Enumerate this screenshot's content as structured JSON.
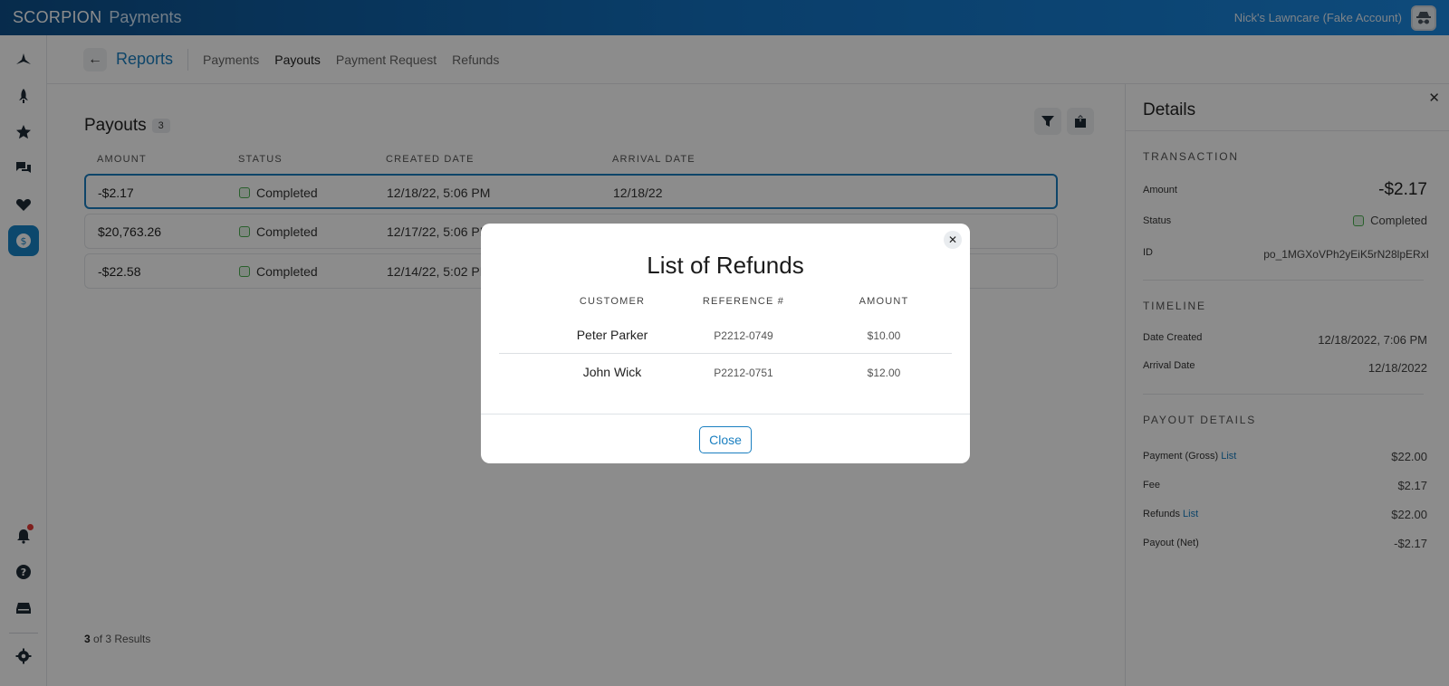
{
  "app": {
    "brand": "SCORPION",
    "product": "Payments",
    "account_name": "Nick's Lawncare (Fake Account)"
  },
  "header": {
    "title": "Reports",
    "tabs": [
      "Payments",
      "Payouts",
      "Payment Request",
      "Refunds"
    ],
    "active_tab": "Payouts"
  },
  "payouts": {
    "title": "Payouts",
    "count": "3",
    "columns": [
      "AMOUNT",
      "STATUS",
      "CREATED DATE",
      "ARRIVAL DATE"
    ],
    "rows": [
      {
        "amount": "-$2.17",
        "status": "Completed",
        "created": "12/18/22, 5:06 PM",
        "arrival": "12/18/22"
      },
      {
        "amount": "$20,763.26",
        "status": "Completed",
        "created": "12/17/22, 5:06 PM",
        "arrival": ""
      },
      {
        "amount": "-$22.58",
        "status": "Completed",
        "created": "12/14/22, 5:02 PM",
        "arrival": ""
      }
    ],
    "results_count": "3",
    "results_rest": " of 3 Results"
  },
  "details": {
    "title": "Details",
    "transaction_title": "TRANSACTION",
    "amount_label": "Amount",
    "amount_value": "-$2.17",
    "status_label": "Status",
    "status_value": "Completed",
    "id_label": "ID",
    "id_value": "po_1MGXoVPh2yEiK5rN28lpERxI",
    "timeline_title": "TIMELINE",
    "created_label": "Date Created",
    "created_value": "12/18/2022, 7:06 PM",
    "arrival_label": "Arrival Date",
    "arrival_value": "12/18/2022",
    "payout_title": "PAYOUT DETAILS",
    "gross_label": "Payment (Gross)",
    "gross_link": "List",
    "gross_value": "$22.00",
    "fee_label": "Fee",
    "fee_value": "$2.17",
    "refunds_label": "Refunds",
    "refunds_link": "List",
    "refunds_value": "$22.00",
    "net_label": "Payout (Net)",
    "net_value": "-$2.17"
  },
  "modal": {
    "title": "List of Refunds",
    "columns": [
      "CUSTOMER",
      "REFERENCE #",
      "AMOUNT"
    ],
    "rows": [
      {
        "customer": "Peter Parker",
        "reference": "P2212-0749",
        "amount": "$10.00"
      },
      {
        "customer": "John Wick",
        "reference": "P2212-0751",
        "amount": "$12.00"
      }
    ],
    "close_label": "Close"
  },
  "colors": {
    "accent": "#1a7fc0",
    "status_completed": "#4caf50",
    "topbar_start": "#0d4f8a",
    "topbar_end": "#1a88e0"
  }
}
